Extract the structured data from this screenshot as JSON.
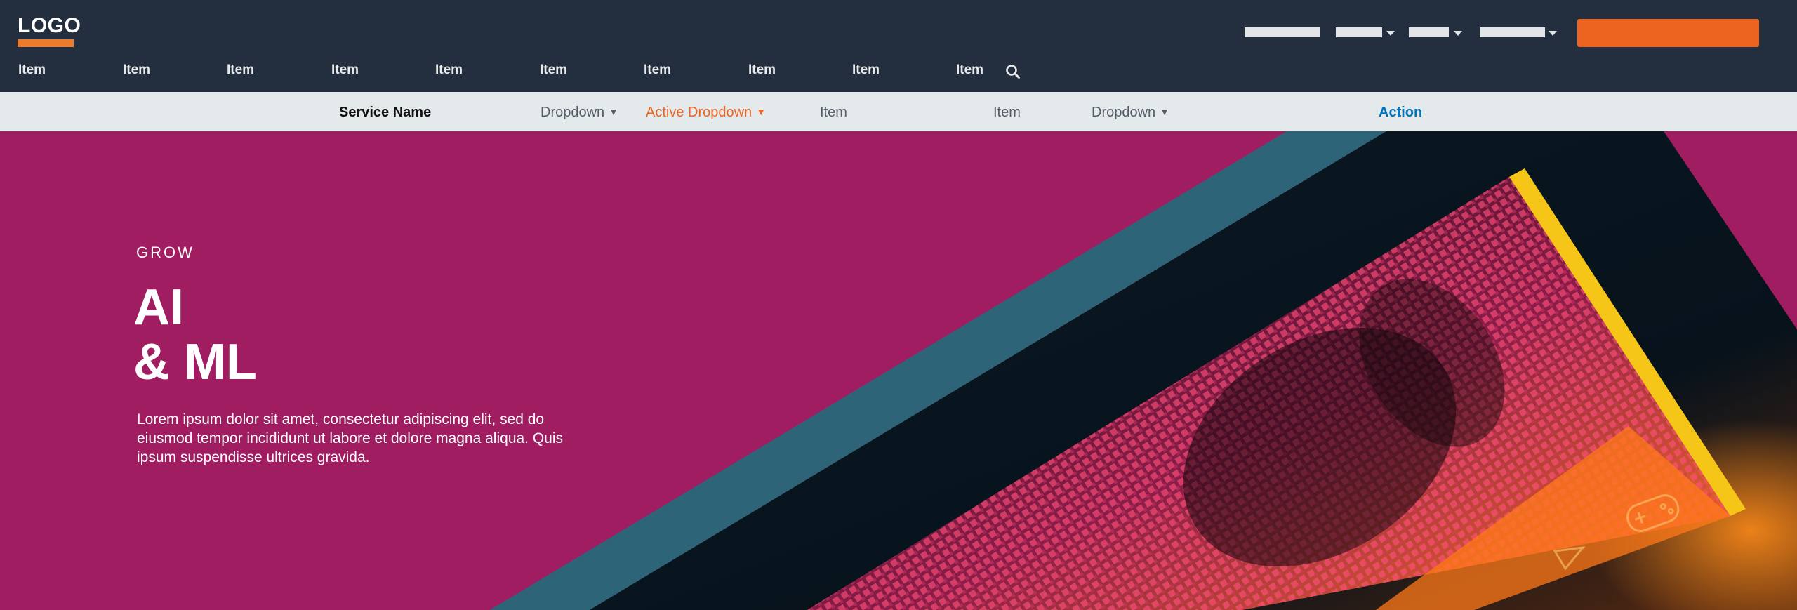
{
  "logo": {
    "text": "LOGO"
  },
  "main_nav": {
    "items": [
      "Item",
      "Item",
      "Item",
      "Item",
      "Item",
      "Item",
      "Item",
      "Item",
      "Item",
      "Item"
    ]
  },
  "sub_nav": {
    "service_name": "Service Name",
    "dropdown_1": "Dropdown",
    "active_dropdown": "Active Dropdown",
    "item_1": "Item",
    "item_2": "Item",
    "dropdown_2": "Dropdown",
    "action": "Action"
  },
  "hero": {
    "eyebrow": "GROW",
    "headline_line1": "AI",
    "headline_line2": "& ML",
    "body": "Lorem ipsum dolor sit amet, consectetur adipiscing elit, sed do eiusmod tempor incididunt ut labore et dolore magna aliqua. Quis ipsum suspendisse ultrices gravida."
  },
  "icons": {
    "search": "search-icon",
    "caret": "caret-down-icon",
    "gamepad": "gamepad-icon",
    "triangle": "triangle-icon"
  },
  "colors": {
    "nav_bg": "#232f3e",
    "subnav_bg": "#e4e9ec",
    "accent_orange": "#ec6420",
    "logo_orange": "#ec7b2d",
    "hero_magenta": "#a11d62",
    "teal_stripe": "#2e6478",
    "dark_panel": "#07121b",
    "gold_edge": "#f5c518",
    "action_blue": "#0073bb"
  }
}
